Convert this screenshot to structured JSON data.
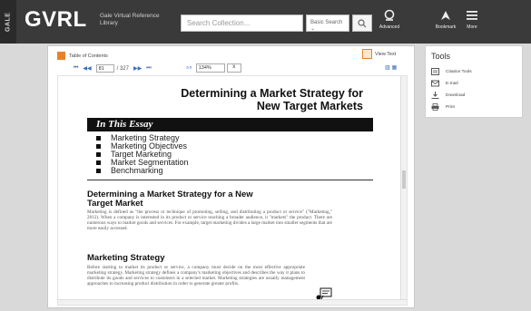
{
  "header": {
    "gale_label": "GALE",
    "logo": "GVRL",
    "logo_sub": "Gale Virtual Reference Library",
    "search_placeholder": "Search Collection...",
    "search_type": "Basic Search",
    "buttons": {
      "advanced": "Advanced",
      "bookmark": "Bookmark",
      "more": "More"
    }
  },
  "viewer": {
    "toc_label": "Table of Contents",
    "view_text_label": "View Text",
    "page_current": "81",
    "page_total": "/ 327",
    "zoom": "134%",
    "zoom_clear": "x"
  },
  "document": {
    "title_line1": "Determining a Market Strategy for",
    "title_line2": "New Target Markets",
    "essay_heading": "In This Essay",
    "essay_items": [
      "Marketing Strategy",
      "Marketing Objectives",
      "Target Marketing",
      "Market Segmentation",
      "Benchmarking"
    ],
    "section1": {
      "heading_line1": "Determining a Market Strategy for a New",
      "heading_line2": "Target Market",
      "body": "Marketing is defined as \"the process or technique of promoting, selling, and distributing a product or service\" (\"Marketing,\" 2012). When a company is interested in its product or service reaching a broader audience, it \"markets\" the product. There are numerous ways to market goods and services. For example, target marketing divides a large market into smaller segments that are more easily accessed."
    },
    "section2": {
      "heading": "Marketing Strategy",
      "body": "Before starting to market its product or service, a company must decide on the most effective appropriate marketing strategy. Marketing strategy defines a company's marketing objectives and describes the way it plans to distribute its goods and services to customers in a selected market. Marketing strategies are usually management approaches to increasing product distribution in order to generate greater profits."
    }
  },
  "tools": {
    "title": "Tools",
    "items": [
      {
        "label": "Citation Tools",
        "icon": "citation-icon"
      },
      {
        "label": "E-mail",
        "icon": "email-icon"
      },
      {
        "label": "Download",
        "icon": "download-icon"
      },
      {
        "label": "Print",
        "icon": "print-icon"
      }
    ]
  },
  "colors": {
    "header_bg": "#3a3a3a",
    "accent_orange": "#e8822a",
    "link_blue": "#3a6bb5"
  }
}
